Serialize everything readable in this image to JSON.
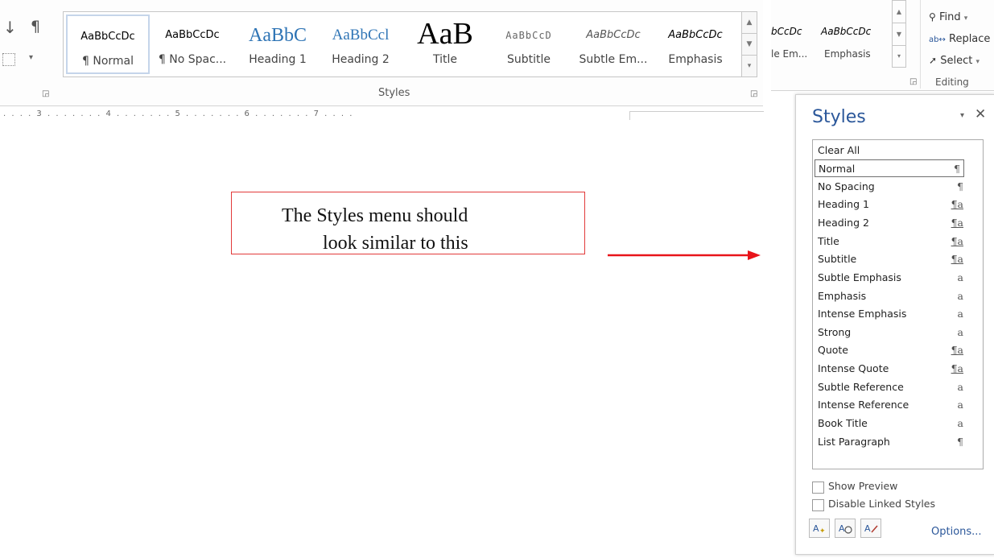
{
  "ribbon": {
    "gallery_items": [
      {
        "preview": "AaBbCcDc",
        "label": "¶ Normal"
      },
      {
        "preview": "AaBbCcDc",
        "label": "¶ No Spac..."
      },
      {
        "preview": "AaBbC",
        "label": "Heading 1"
      },
      {
        "preview": "AaBbCcl",
        "label": "Heading 2"
      },
      {
        "preview": "AaB",
        "label": "Title"
      },
      {
        "preview": "AaBbCcD",
        "label": "Subtitle"
      },
      {
        "preview": "AaBbCcDc",
        "label": "Subtle Em..."
      },
      {
        "preview": "AaBbCcDc",
        "label": "Emphasis"
      }
    ],
    "group_label": "Styles",
    "ruler_text": ". . . . 3 . . . . . . . 4 . . . . . . . 5 . . . . . . . 6 . . . . . . . 7 . . . ."
  },
  "ribbon_right": {
    "gallery_items": [
      {
        "preview": "bCcDc",
        "label": "le Em..."
      },
      {
        "preview": "AaBbCcDc",
        "label": "Emphasis"
      }
    ],
    "find_label": "Find",
    "replace_label": "Replace",
    "select_label": "Select",
    "group_label": "Editing"
  },
  "callout": {
    "line1": "The Styles menu should",
    "line2": "look similar to this"
  },
  "colors": {
    "callout_border": "#e23a3a",
    "arrow": "#e8141a",
    "pane_title": "#2b579a"
  },
  "styles_pane": {
    "title": "Styles",
    "items": [
      {
        "name": "Clear All",
        "mark": ""
      },
      {
        "name": "Normal",
        "mark": "¶"
      },
      {
        "name": "No Spacing",
        "mark": "¶"
      },
      {
        "name": "Heading 1",
        "mark": "¶a"
      },
      {
        "name": "Heading 2",
        "mark": "¶a"
      },
      {
        "name": "Title",
        "mark": "¶a"
      },
      {
        "name": "Subtitle",
        "mark": "¶a"
      },
      {
        "name": "Subtle Emphasis",
        "mark": "a"
      },
      {
        "name": "Emphasis",
        "mark": "a"
      },
      {
        "name": "Intense Emphasis",
        "mark": "a"
      },
      {
        "name": "Strong",
        "mark": "a"
      },
      {
        "name": "Quote",
        "mark": "¶a"
      },
      {
        "name": "Intense Quote",
        "mark": "¶a"
      },
      {
        "name": "Subtle Reference",
        "mark": "a"
      },
      {
        "name": "Intense Reference",
        "mark": "a"
      },
      {
        "name": "Book Title",
        "mark": "a"
      },
      {
        "name": "List Paragraph",
        "mark": "¶"
      }
    ],
    "show_preview_label": "Show Preview",
    "disable_linked_label": "Disable Linked Styles",
    "options_label": "Options..."
  }
}
